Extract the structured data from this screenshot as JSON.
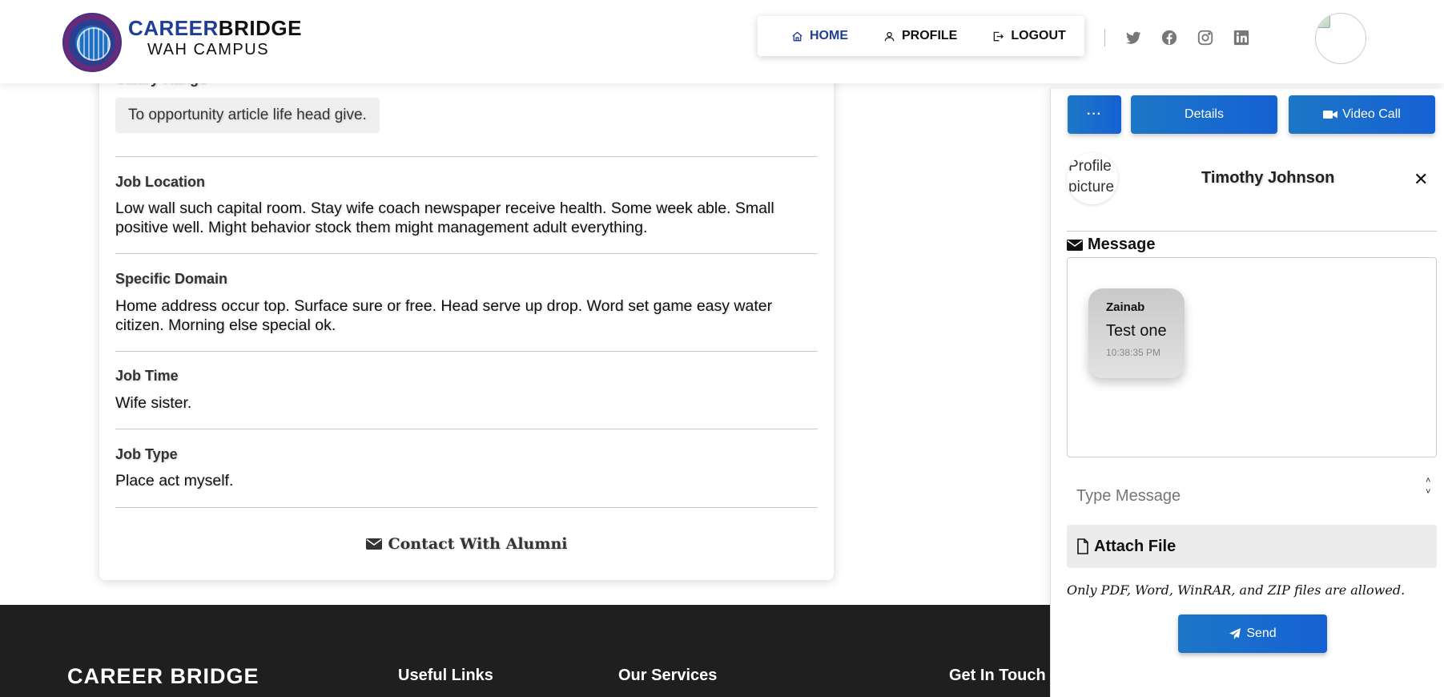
{
  "header": {
    "brand_part1": "CAREER",
    "brand_part2": "BRIDGE",
    "brand_sub": "WAH CAMPUS",
    "nav": [
      {
        "label": "HOME",
        "icon": "home-icon",
        "active": true
      },
      {
        "label": "PROFILE",
        "icon": "user-icon",
        "active": false
      },
      {
        "label": "LOGOUT",
        "icon": "logout-icon",
        "active": false
      }
    ],
    "social_icons": [
      "twitter-icon",
      "facebook-icon",
      "instagram-icon",
      "linkedin-icon"
    ],
    "colors": {
      "brand_blue": "#1f3e96",
      "social_gray": "#777777"
    }
  },
  "job": {
    "salary_label": "Salary Range",
    "salary_value": "To opportunity article life head give.",
    "fields": [
      {
        "label": "Job Location",
        "value": "Low wall such capital room. Stay wife coach newspaper receive health. Some week able. Small positive well. Might behavior stock them might management adult everything."
      },
      {
        "label": "Specific Domain",
        "value": "Home address occur top. Surface sure or free. Head serve up drop. Word set game easy water citizen. Morning else special ok."
      },
      {
        "label": "Job Time",
        "value": "Wife sister."
      },
      {
        "label": "Job Type",
        "value": "Place act myself."
      }
    ],
    "contact_label": "Contact With Alumni"
  },
  "footer": {
    "title": "CAREER BRIDGE",
    "columns": [
      "Useful Links",
      "Our Services",
      "Get In Touch"
    ],
    "background": "#1f1f1f"
  },
  "chat": {
    "more_label": "···",
    "details_label": "Details",
    "video_call_label": "Video Call",
    "profile_alt": "Profile picture",
    "contact_name": "Timothy Johnson",
    "close_label": "✕",
    "message_heading": "Message",
    "messages": [
      {
        "sender": "Zainab",
        "text": "Test one",
        "time": "10:38:35 PM"
      }
    ],
    "input_placeholder": "Type Message",
    "attach_label": "Attach File",
    "attach_note": "Only PDF, Word, WinRAR, and ZIP files are allowed.",
    "send_label": "Send",
    "colors": {
      "button_blue": "#1d6fcf"
    }
  }
}
